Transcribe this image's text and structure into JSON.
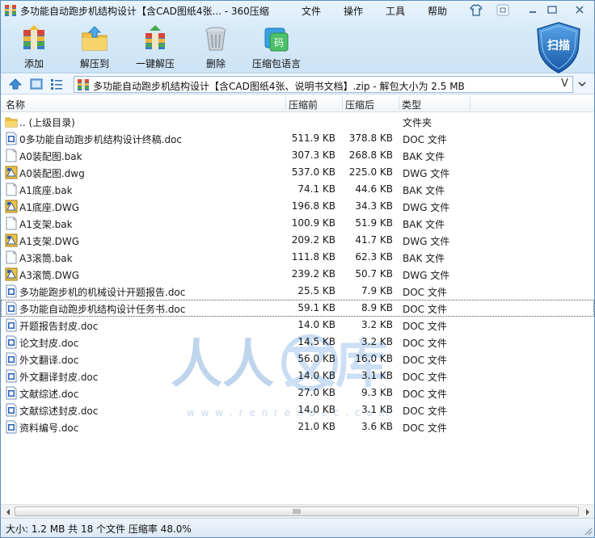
{
  "window": {
    "title": "多功能自动跑步机结构设计【含CAD图纸4张... - 360压缩",
    "menu": [
      "文件",
      "操作",
      "工具",
      "帮助"
    ]
  },
  "toolbar": {
    "buttons": [
      {
        "label": "添加",
        "icon": "add-archive-icon"
      },
      {
        "label": "解压到",
        "icon": "extract-to-folder-icon"
      },
      {
        "label": "一键解压",
        "icon": "one-click-extract-icon"
      },
      {
        "label": "删除",
        "icon": "trash-bin-icon"
      },
      {
        "label": "压缩包语言",
        "icon": "archive-language-icon"
      }
    ],
    "scan_label": "扫描"
  },
  "address": {
    "path": "多功能自动跑步机结构设计【含CAD图纸4张、说明书文档】.zip - 解包大小为 2.5 MB",
    "v_marker": "V"
  },
  "columns": {
    "name": "名称",
    "size": "压缩前",
    "compressed": "压缩后",
    "type": "类型"
  },
  "files": [
    {
      "name": ".. (上级目录)",
      "size": "",
      "compressed": "",
      "type": "文件夹",
      "icon": "folder"
    },
    {
      "name": "0多功能自动跑步机结构设计终稿.doc",
      "size": "511.9 KB",
      "compressed": "378.8 KB",
      "type": "DOC 文件",
      "icon": "doc"
    },
    {
      "name": "A0装配图.bak",
      "size": "307.3 KB",
      "compressed": "268.8 KB",
      "type": "BAK 文件",
      "icon": "bak"
    },
    {
      "name": "A0装配图.dwg",
      "size": "537.0 KB",
      "compressed": "225.0 KB",
      "type": "DWG 文件",
      "icon": "dwg"
    },
    {
      "name": "A1底座.bak",
      "size": "74.1 KB",
      "compressed": "44.6 KB",
      "type": "BAK 文件",
      "icon": "bak"
    },
    {
      "name": "A1底座.DWG",
      "size": "196.8 KB",
      "compressed": "34.3 KB",
      "type": "DWG 文件",
      "icon": "dwg"
    },
    {
      "name": "A1支架.bak",
      "size": "100.9 KB",
      "compressed": "51.9 KB",
      "type": "BAK 文件",
      "icon": "bak"
    },
    {
      "name": "A1支架.DWG",
      "size": "209.2 KB",
      "compressed": "41.7 KB",
      "type": "DWG 文件",
      "icon": "dwg"
    },
    {
      "name": "A3滚筒.bak",
      "size": "111.8 KB",
      "compressed": "62.3 KB",
      "type": "BAK 文件",
      "icon": "bak"
    },
    {
      "name": "A3滚筒.DWG",
      "size": "239.2 KB",
      "compressed": "50.7 KB",
      "type": "DWG 文件",
      "icon": "dwg"
    },
    {
      "name": "多功能跑步机的机械设计开题报告.doc",
      "size": "25.5 KB",
      "compressed": "7.9 KB",
      "type": "DOC 文件",
      "icon": "doc"
    },
    {
      "name": "多功能自动跑步机结构设计任务书.doc",
      "size": "59.1 KB",
      "compressed": "8.9 KB",
      "type": "DOC 文件",
      "icon": "doc",
      "selected": true
    },
    {
      "name": "开题报告封皮.doc",
      "size": "14.0 KB",
      "compressed": "3.2 KB",
      "type": "DOC 文件",
      "icon": "doc"
    },
    {
      "name": "论文封皮.doc",
      "size": "14.5 KB",
      "compressed": "3.2 KB",
      "type": "DOC 文件",
      "icon": "doc"
    },
    {
      "name": "外文翻译.doc",
      "size": "56.0 KB",
      "compressed": "16.0 KB",
      "type": "DOC 文件",
      "icon": "doc"
    },
    {
      "name": "外文翻译封皮.doc",
      "size": "14.0 KB",
      "compressed": "3.1 KB",
      "type": "DOC 文件",
      "icon": "doc"
    },
    {
      "name": "文献综述.doc",
      "size": "27.0 KB",
      "compressed": "9.3 KB",
      "type": "DOC 文件",
      "icon": "doc"
    },
    {
      "name": "文献综述封皮.doc",
      "size": "14.0 KB",
      "compressed": "3.1 KB",
      "type": "DOC 文件",
      "icon": "doc"
    },
    {
      "name": "资料编号.doc",
      "size": "21.0 KB",
      "compressed": "3.6 KB",
      "type": "DOC 文件",
      "icon": "doc"
    }
  ],
  "watermark": {
    "text": "人人文库",
    "url": "w w w . r e n r e n d o c . c o m"
  },
  "status": "大小: 1.2 MB 共 18 个文件 压缩率 48.0%",
  "colors": {
    "accent": "#2a6fc0",
    "shield": "#1e64b4",
    "doc_icon": "#2b5fb8",
    "folder": "#e8b830"
  }
}
